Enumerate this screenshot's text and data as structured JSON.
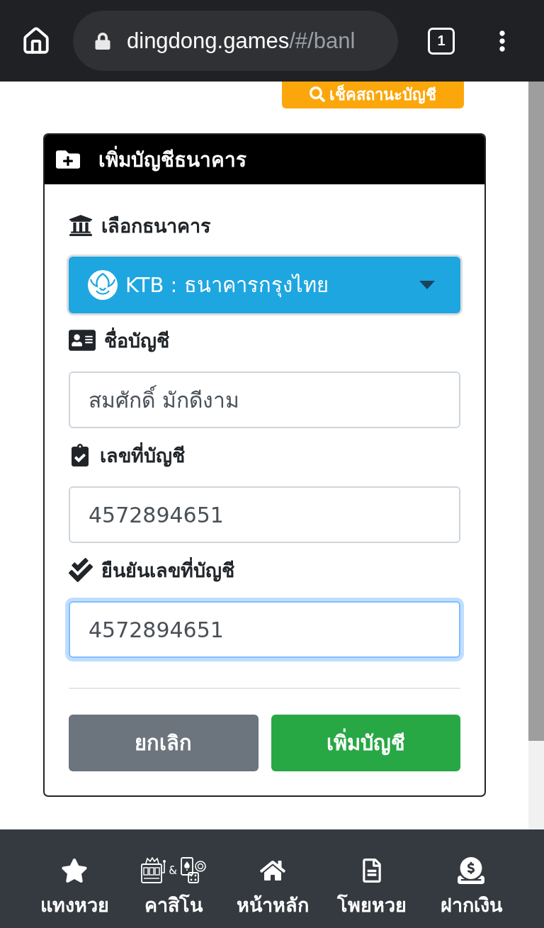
{
  "browser": {
    "url_host": "dingdong.games",
    "url_path": "/#/banl",
    "tab_count": "1"
  },
  "status_button": {
    "label": "เช็คสถานะบัญชี"
  },
  "card": {
    "title": "เพิ่มบัญชีธนาคาร",
    "fields": [
      {
        "kind": "select",
        "label": "เลือกธนาคาร",
        "value": "KTB : ธนาคารกรุงไทย"
      },
      {
        "kind": "text",
        "label": "ชื่อบัญชี",
        "value": "สมศักดิ์ มักดีงาม",
        "focused": false
      },
      {
        "kind": "text",
        "label": "เลขที่บัญชี",
        "value": "4572894651",
        "focused": false
      },
      {
        "kind": "text",
        "label": "ยืนยันเลขที่บัญชี",
        "value": "4572894651",
        "focused": true
      }
    ],
    "buttons": [
      {
        "kind": "cancel",
        "label": "ยกเลิก"
      },
      {
        "kind": "submit",
        "label": "เพิ่มบัญชี"
      }
    ]
  },
  "bottom_nav": [
    {
      "label": "แทงหวย"
    },
    {
      "label": "คาสิโน",
      "icon_joiner": "&"
    },
    {
      "label": "หน้าหลัก"
    },
    {
      "label": "โพยหวย"
    },
    {
      "label": "ฝากเงิน"
    }
  ]
}
